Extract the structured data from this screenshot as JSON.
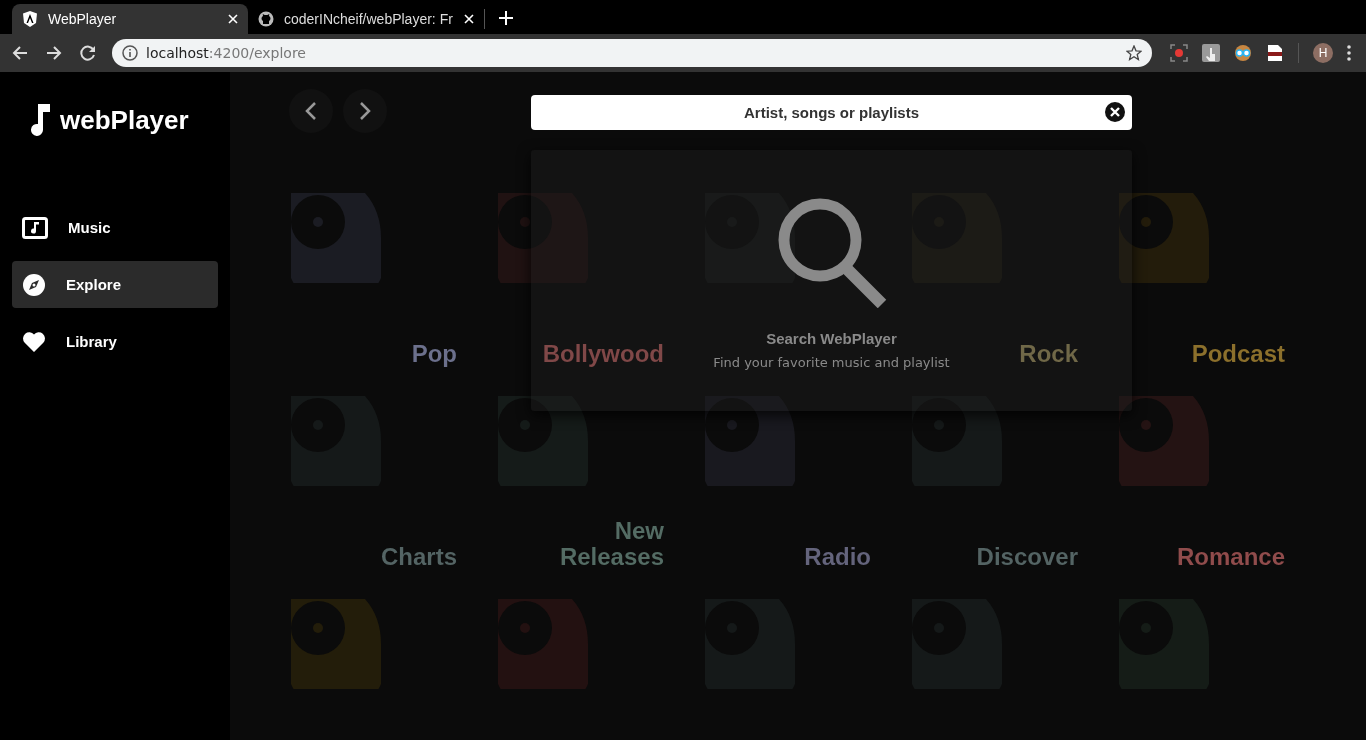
{
  "browser": {
    "tabs": [
      {
        "title": "WebPlayer",
        "selected": true,
        "kind": "shield"
      },
      {
        "title": "coderINcheif/webPlayer: Fr",
        "selected": false,
        "kind": "octocat"
      }
    ],
    "address": {
      "host": "localhost",
      "path": ":4200/explore"
    },
    "profile": "H"
  },
  "sidebar": {
    "logo": "webPlayer",
    "items": [
      {
        "label": "Music",
        "selected": false,
        "kind": "music"
      },
      {
        "label": "Explore",
        "selected": true,
        "kind": "compass"
      },
      {
        "label": "Library",
        "selected": false,
        "kind": "heart"
      }
    ]
  },
  "search": {
    "placeholder": "Artist, songs or playlists"
  },
  "search_panel": {
    "title": "Search WebPlayer",
    "subtitle": "Find your favorite music and playlist"
  },
  "categories": [
    {
      "label": "Pop",
      "color": "#1b1c23"
    },
    {
      "label": "Bollywood",
      "color": "#201212"
    },
    {
      "color": "#161918"
    },
    {
      "label": "Rock",
      "color": "#1c1a12"
    },
    {
      "label": "Podcast",
      "color": "#231c0b"
    },
    {
      "label": "Charts",
      "color": "#151919"
    },
    {
      "label": "New Releases",
      "color": "#151b19"
    },
    {
      "label": "Radio",
      "color": "#19191f"
    },
    {
      "label": "Discover",
      "color": "#151919"
    },
    {
      "label": "Romance",
      "color": "#241313"
    },
    {
      "color": "#231d0a"
    },
    {
      "color": "#231111"
    },
    {
      "color": "#151919"
    },
    {
      "color": "#151919"
    },
    {
      "color": "#151c17"
    }
  ]
}
